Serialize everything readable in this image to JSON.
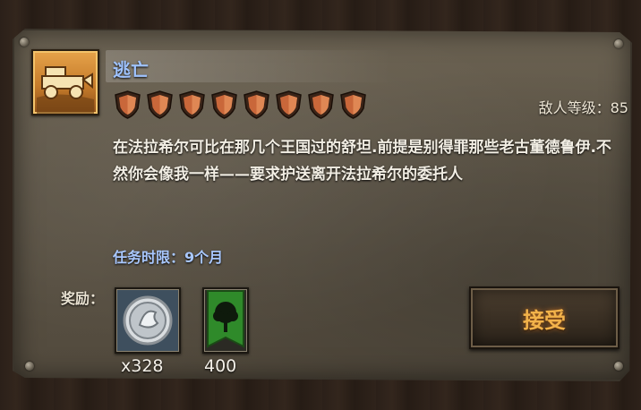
{
  "quest": {
    "title": "逃亡",
    "icon": "wagon-icon",
    "difficulty_shields": 8,
    "enemy_level_text": "敌人等级：85",
    "description": "在法拉希尔可比在那几个王国过的舒坦.前提是别得罪那些老古董德鲁伊.不然你会像我一样——要求护送离开法拉希尔的委托人",
    "time_limit": "任务时限：9个月"
  },
  "rewards": {
    "label": "奖励：",
    "items": [
      {
        "icon": "silver-coin-icon",
        "count": "x328"
      },
      {
        "icon": "tree-banner-icon",
        "count": "400"
      }
    ]
  },
  "actions": {
    "accept_label": "接受"
  },
  "colors": {
    "title": "#9fc3ff",
    "accept_text": "#f2b24a",
    "shield": "#c9673a",
    "banner": "#2f8a2a"
  }
}
